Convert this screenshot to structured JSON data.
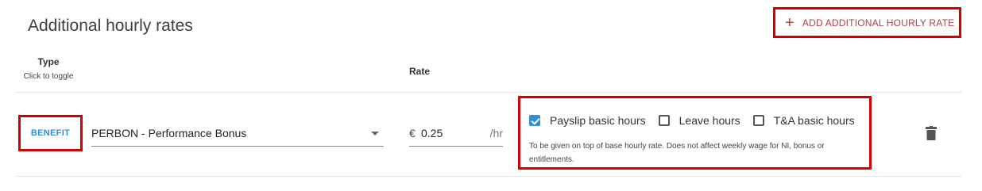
{
  "section": {
    "title": "Additional hourly rates",
    "add_button_label": "ADD ADDITIONAL HOURLY RATE",
    "add_button_icon": "plus-icon"
  },
  "columns": {
    "type_header": "Type",
    "type_hint": "Click to toggle",
    "rate_header": "Rate"
  },
  "row": {
    "type_toggle_label": "BENEFIT",
    "rate_code_selected": "PERBON - Performance Bonus",
    "currency_symbol": "€",
    "rate_value": "0.25",
    "rate_unit": "/hr",
    "options": [
      {
        "label": "Payslip basic hours",
        "checked": true
      },
      {
        "label": "Leave hours",
        "checked": false
      },
      {
        "label": "T&A basic hours",
        "checked": false
      }
    ],
    "help_text": "To be given on top of base hourly rate. Does not affect weekly wage for NI, bonus or entitlements.",
    "delete_icon": "trash-icon"
  },
  "colors": {
    "accent_blue": "#2f8fd1",
    "add_button_text": "#b33f3f",
    "highlight_border": "#d60000"
  }
}
